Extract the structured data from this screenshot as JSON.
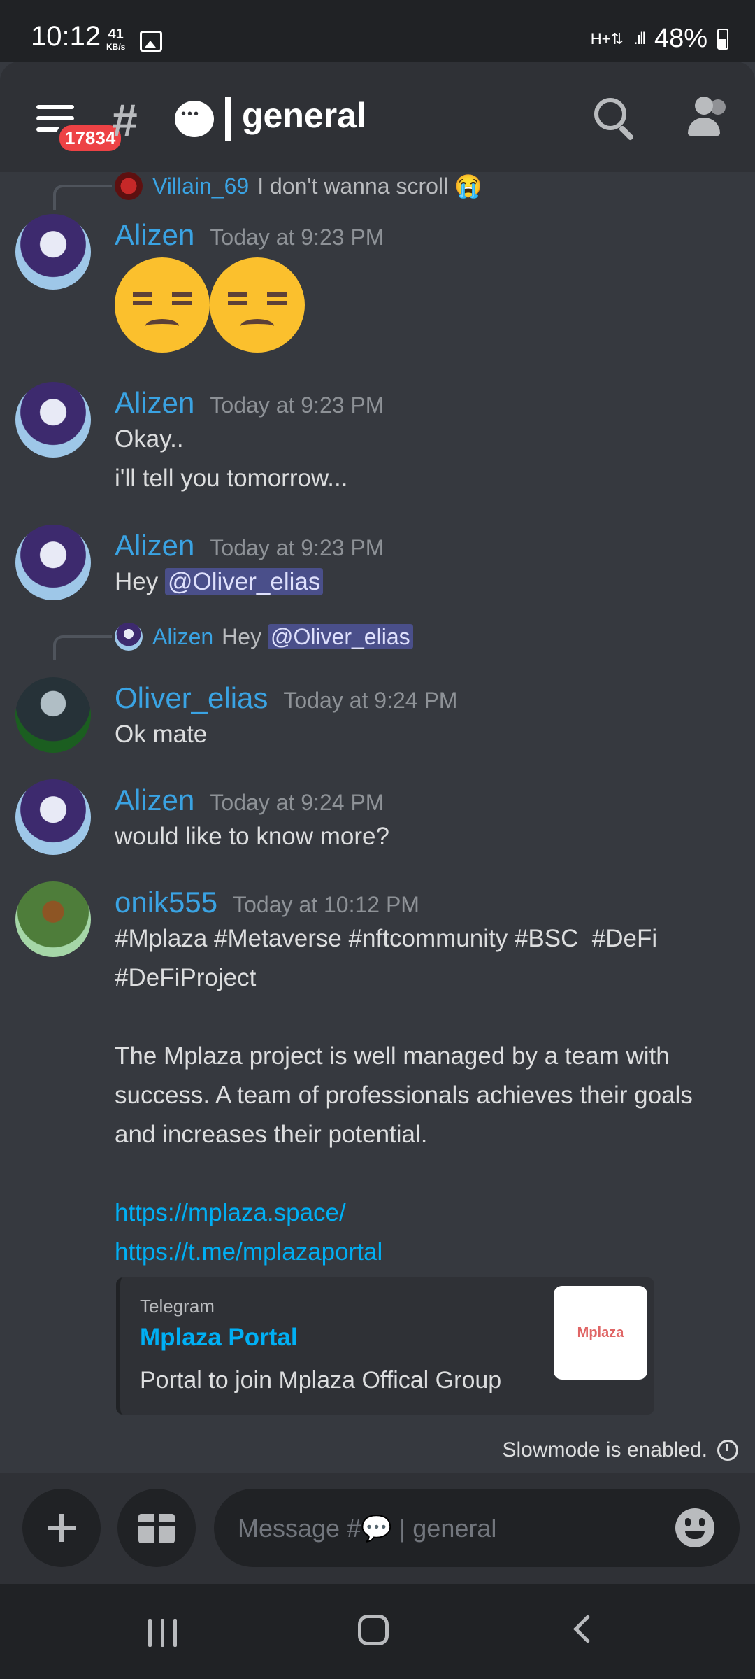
{
  "status_bar": {
    "time": "10:12",
    "net_speed": "41",
    "net_unit": "KB/s",
    "battery": "48%"
  },
  "header": {
    "badge_count": "17834",
    "channel_name": "general"
  },
  "messages": [
    {
      "reply_to": {
        "user": "Villain_69",
        "text": "I don't wanna scroll 😭"
      },
      "user": "Alizen",
      "time": "Today at 9:23 PM",
      "type": "emoji",
      "emoji": [
        "unamused-face",
        "unamused-face"
      ]
    },
    {
      "user": "Alizen",
      "time": "Today at 9:23 PM",
      "text": "Okay..\ni'll tell you tomorrow..."
    },
    {
      "user": "Alizen",
      "time": "Today at 9:23 PM",
      "text_prefix": "Hey ",
      "mention": "@Oliver_elias"
    },
    {
      "reply_to": {
        "user": "Alizen",
        "text_prefix": "Hey ",
        "mention": "@Oliver_elias"
      },
      "user": "Oliver_elias",
      "time": "Today at 9:24 PM",
      "text": "Ok mate"
    },
    {
      "user": "Alizen",
      "time": "Today at 9:24 PM",
      "text": "would like to know more?"
    },
    {
      "user": "onik555",
      "time": "Today at 10:12 PM",
      "text": "#Mplaza #Metaverse #nftcommunity #BSC  #DeFi\n#DeFiProject\n\nThe Mplaza project is well managed by a team with success. A team of professionals achieves their goals and increases their potential.",
      "links": [
        "https://mplaza.space/",
        "https://t.me/mplazaportal"
      ],
      "embed": {
        "provider": "Telegram",
        "title": "Mplaza Portal",
        "description": "Portal to join Mplaza Offical Group",
        "thumb_label": "Mplaza"
      }
    }
  ],
  "slowmode": {
    "text": "Slowmode is enabled."
  },
  "composer": {
    "placeholder": "Message #💬 | general"
  },
  "colors": {
    "accent_name": "#3aa3e3",
    "link": "#00aff4",
    "background": "#36393f",
    "header": "#2f3136",
    "badge": "#ed4245"
  }
}
